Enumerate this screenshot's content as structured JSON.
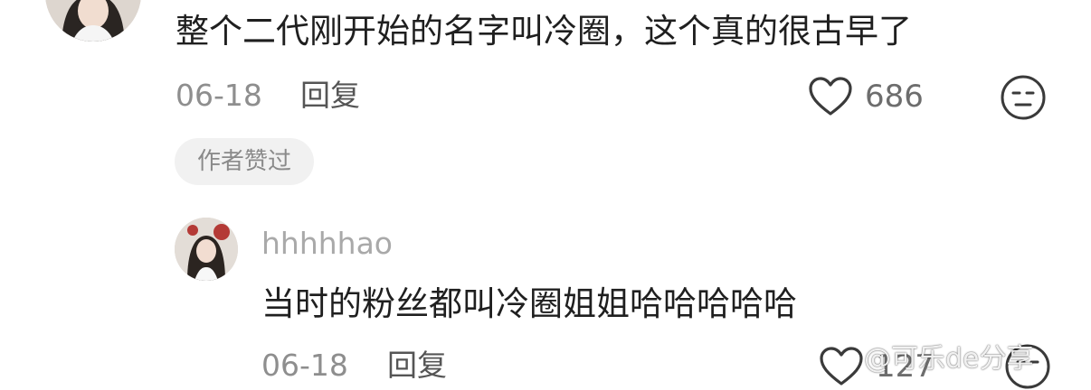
{
  "top_comment": {
    "text": "整个二代刚开始的名字叫冷圈，这个真的很古早了",
    "date": "06-18",
    "reply_label": "回复",
    "like_count": "686",
    "author_liked_badge": "作者赞过"
  },
  "reply_comment": {
    "username": "hhhhhao",
    "text": "当时的粉丝都叫冷圈姐姐哈哈哈哈哈",
    "date": "06-18",
    "reply_label": "回复",
    "like_count": "127"
  },
  "watermark": "@可乐de分享",
  "icons": {
    "like": "heart-outline-icon",
    "emoji": "neutral-face-icon"
  }
}
